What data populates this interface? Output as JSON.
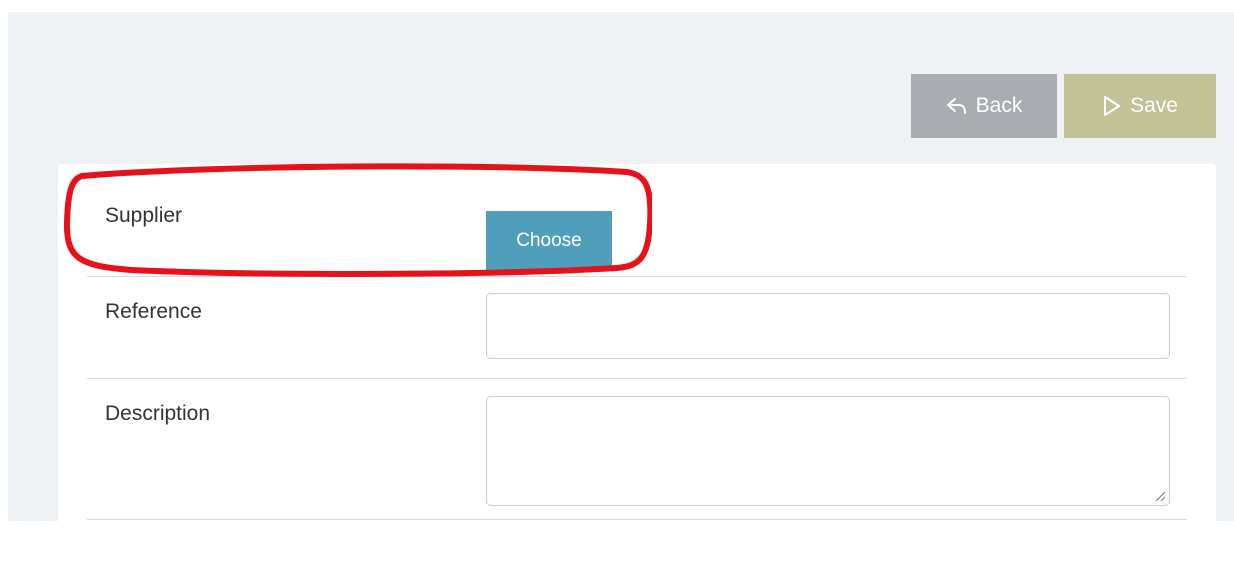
{
  "toolbar": {
    "back_label": "Back",
    "save_label": "Save"
  },
  "form": {
    "supplier": {
      "label": "Supplier",
      "button_label": "Choose"
    },
    "reference": {
      "label": "Reference",
      "value": ""
    },
    "description": {
      "label": "Description",
      "value": ""
    }
  },
  "icons": {
    "back": "reply-arrow-icon",
    "save": "play-triangle-icon",
    "resize": "resize-grip-icon"
  },
  "colors": {
    "page_bg": "#eef2f5",
    "back_button": "#a9acb1",
    "save_button": "#c2c197",
    "choose_button": "#4f9fbc",
    "highlight": "#e5121c"
  }
}
